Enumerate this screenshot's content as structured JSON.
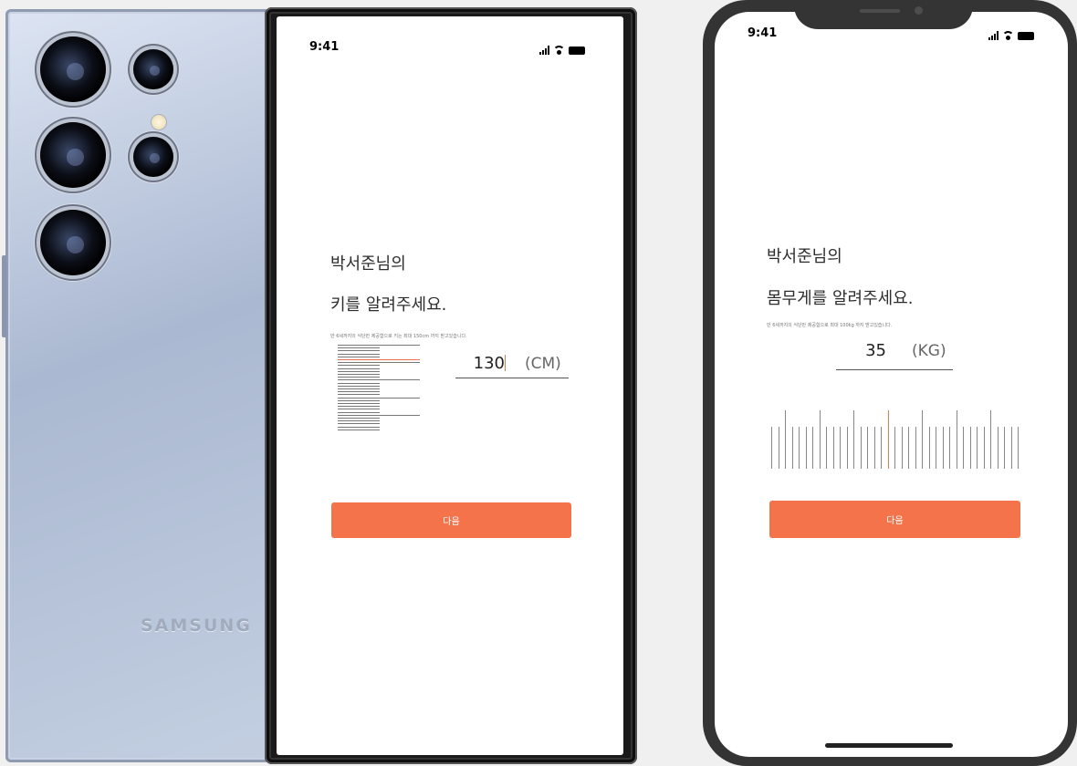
{
  "samsung_back": {
    "brand": "SAMSUNG",
    "body_color": "#b4c2db"
  },
  "height_screen": {
    "status_time": "9:41",
    "title_line1": "박서준님의",
    "title_line2": "키를 알려주세요.",
    "hint": "만 6세까지의 식단만 제공함으로 키는 최대 150cm 까지 받고있습니다.",
    "value": "130",
    "unit": "(CM)",
    "next_label": "다음"
  },
  "weight_screen": {
    "status_time": "9:41",
    "title_line1": "박서준님의",
    "title_line2": "몸무게를 알려주세요.",
    "hint": "만 6세까지의 식단만 제공함으로 최대 100kg 까지 받고있습니다.",
    "value": "35",
    "unit": "(KG)",
    "next_label": "다음"
  },
  "colors": {
    "accent": "#f5734b",
    "iphone_frame": "#343434",
    "background": "#f0f0f0"
  },
  "icons": [
    "signal-icon",
    "wifi-icon",
    "battery-icon"
  ]
}
